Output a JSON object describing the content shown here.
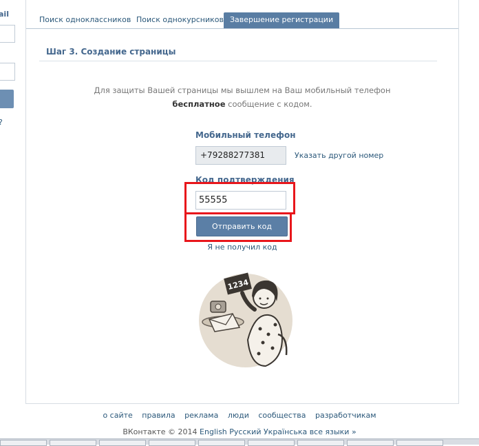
{
  "sidebar": {
    "email_label": "ail",
    "question_mark": "?"
  },
  "tabs": [
    {
      "label": "Поиск одноклассников",
      "active": false
    },
    {
      "label": "Поиск однокурсников",
      "active": false
    },
    {
      "label": "Завершение регистрации",
      "active": true
    }
  ],
  "step": {
    "title": "Шаг 3. Создание страницы"
  },
  "info": {
    "line1": "Для защиты Вашей страницы мы вышлем на Ваш мобильный телефон",
    "line2_bold": "бесплатное",
    "line2_rest": " сообщение с кодом."
  },
  "phone": {
    "label": "Мобильный телефон",
    "value": "+79288277381",
    "other_number_link": "Указать другой номер"
  },
  "code": {
    "label": "Код подтверждения",
    "value": "55555"
  },
  "send_button": "Отправить код",
  "not_received_link": "Я не получил код",
  "illustration": {
    "card_text": "1234",
    "icon": "woman-with-phone-illustration"
  },
  "footer": {
    "links": [
      "о сайте",
      "правила",
      "реклама",
      "люди",
      "сообщества",
      "разработчикам"
    ],
    "copyright_prefix": "ВКонтакте © 2014",
    "languages": [
      "English",
      "Русский",
      "Українська",
      "все языки »"
    ]
  },
  "colors": {
    "accent": "#597da3",
    "link": "#2b587a",
    "header_text": "#45688e",
    "highlight_red": "#e8161b"
  }
}
